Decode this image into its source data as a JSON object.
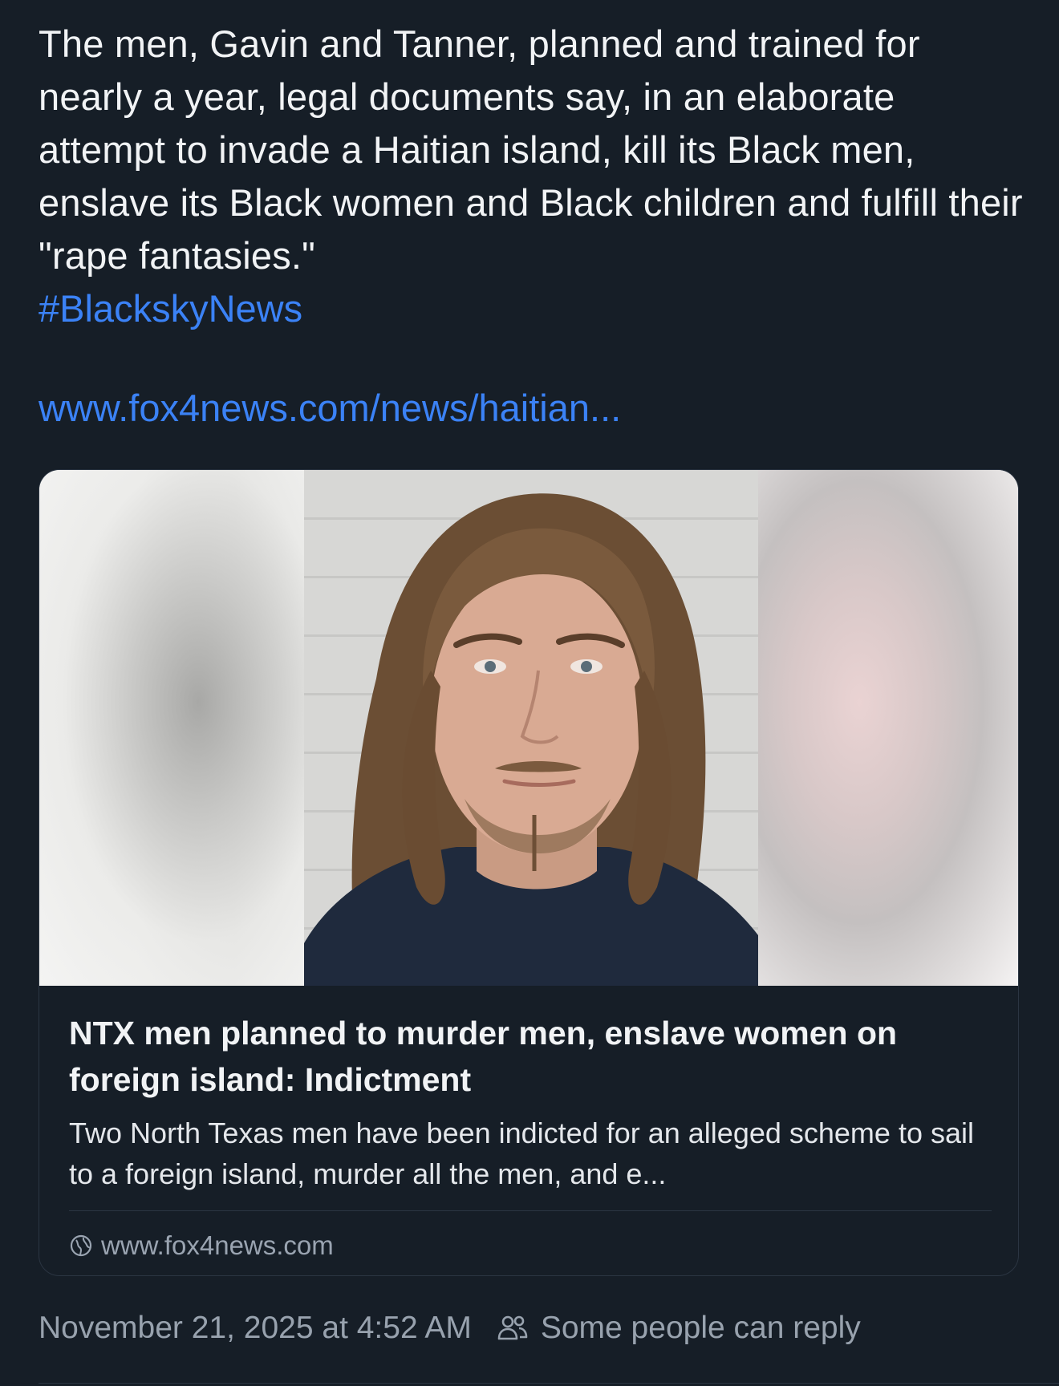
{
  "post": {
    "text": "The men, Gavin and Tanner, planned and trained for nearly a year, legal documents say, in an elaborate attempt to invade a Haitian island, kill its Black men, enslave its Black women and Black children and fulfill their \"rape fantasies.\"",
    "hashtag": "#BlackskyNews",
    "link": "www.fox4news.com/news/haitian..."
  },
  "card": {
    "title": "NTX men planned to murder men, enslave women on foreign island: Indictment",
    "description": "Two North Texas men have been indicted for an alleged scheme to sail to a foreign island, murder all the men, and e...",
    "domain": "www.fox4news.com",
    "domain_icon": "globe-icon"
  },
  "footer": {
    "timestamp": "November 21, 2025 at 4:52 AM",
    "reply_icon": "people-icon",
    "reply_setting": "Some people can reply"
  },
  "colors": {
    "background": "#161e27",
    "text": "#f1f3f5",
    "link": "#3b82f6",
    "muted": "#98a2ae",
    "border": "#2b3542"
  }
}
